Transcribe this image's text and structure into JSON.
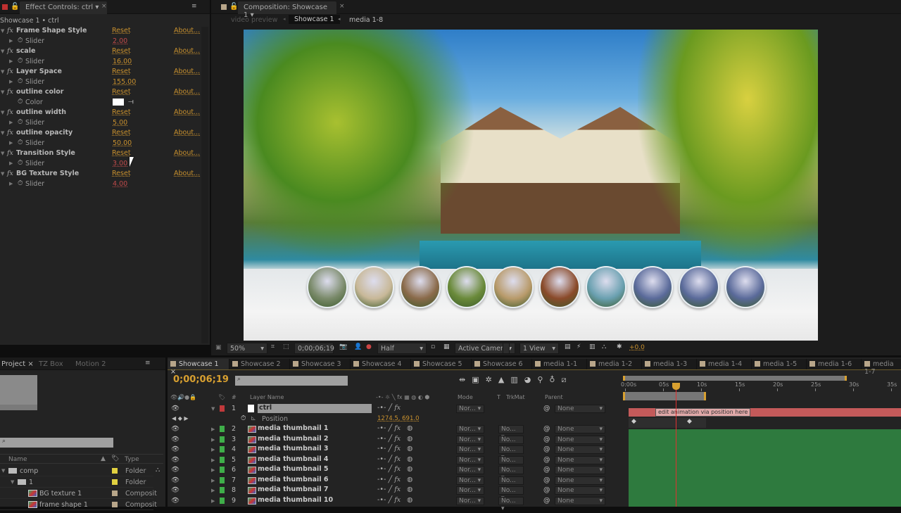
{
  "effect_controls": {
    "title": "Effect Controls: ctrl",
    "subtitle": "Showcase 1 • ctrl",
    "reset": "Reset",
    "about": "About...",
    "effects": [
      {
        "name": "Frame Shape Style",
        "prop": "Slider",
        "value": "2.00",
        "value_color": "#c04a4a"
      },
      {
        "name": "scale",
        "prop": "Slider",
        "value": "16.00",
        "value_color": "#c9912e"
      },
      {
        "name": "Layer Space",
        "prop": "Slider",
        "value": "155.00",
        "value_color": "#c9912e"
      },
      {
        "name": "outline color",
        "prop": "Color",
        "value": "",
        "swatch": "#ffffff"
      },
      {
        "name": "outline width",
        "prop": "Slider",
        "value": "5.00",
        "value_color": "#c9912e"
      },
      {
        "name": "outline opacity",
        "prop": "Slider",
        "value": "50.00",
        "value_color": "#c9912e"
      },
      {
        "name": "Transition Style",
        "prop": "Slider",
        "value": "3.00",
        "value_color": "#c04a4a"
      },
      {
        "name": "BG Texture Style",
        "prop": "Slider",
        "value": "4.00",
        "value_color": "#c04a4a"
      }
    ]
  },
  "composition": {
    "title": "Composition: Showcase 1",
    "breadcrumb": [
      "video preview",
      "Showcase 1",
      "media 1-8"
    ],
    "toolbar": {
      "zoom": "50%",
      "timecode": "0;00;06;19",
      "resolution": "Half",
      "camera": "Active Camera",
      "views": "1 View",
      "exposure": "+0.0"
    }
  },
  "project": {
    "tabs": [
      "Project",
      "TZ Box",
      "Motion 2"
    ],
    "search_placeholder": "",
    "columns": [
      "Name",
      "Type"
    ],
    "items": [
      {
        "name": "comp",
        "type": "Folder",
        "label": "#e0d040",
        "depth": 0,
        "kind": "folder"
      },
      {
        "name": "1",
        "type": "Folder",
        "label": "#e0d040",
        "depth": 1,
        "kind": "folder"
      },
      {
        "name": "BG texture 1",
        "type": "Composit",
        "label": "#b8a68a",
        "depth": 2,
        "kind": "comp"
      },
      {
        "name": "frame shape 1",
        "type": "Composit",
        "label": "#b8a68a",
        "depth": 2,
        "kind": "comp"
      }
    ]
  },
  "timeline": {
    "tabs": [
      "Showcase 1",
      "Showcase 2",
      "Showcase 3",
      "Showcase 4",
      "Showcase 5",
      "Showcase 6",
      "media 1-1",
      "media 1-2",
      "media 1-3",
      "media 1-4",
      "media 1-5",
      "media 1-6",
      "media 1-7"
    ],
    "timecode": "0;00;06;19",
    "columns": {
      "num": "#",
      "name": "Layer Name",
      "mode": "Mode",
      "t": "T",
      "trkmat": "TrkMat",
      "parent": "Parent"
    },
    "ruler": [
      "0:00s",
      "05s",
      "10s",
      "15s",
      "20s",
      "25s",
      "30s",
      "35s"
    ],
    "current_time_seconds": 6.63,
    "position": {
      "label": "Position",
      "value": "1274.5, 691.0"
    },
    "marker_comment": "edit animation via position here",
    "layers": [
      {
        "num": "1",
        "name": "ctrl",
        "label": "#c0393b",
        "mode": "Nor...",
        "trkmat": "",
        "parent": "None",
        "solid": true
      },
      {
        "num": "2",
        "name": "media thumbnail 1",
        "label": "#3fae49",
        "mode": "Nor...",
        "trkmat": "No...",
        "parent": "None"
      },
      {
        "num": "3",
        "name": "media thumbnail 2",
        "label": "#3fae49",
        "mode": "Nor...",
        "trkmat": "No...",
        "parent": "None"
      },
      {
        "num": "4",
        "name": "media thumbnail 3",
        "label": "#3fae49",
        "mode": "Nor...",
        "trkmat": "No...",
        "parent": "None"
      },
      {
        "num": "5",
        "name": "media thumbnail 4",
        "label": "#3fae49",
        "mode": "Nor...",
        "trkmat": "No...",
        "parent": "None"
      },
      {
        "num": "6",
        "name": "media thumbnail 5",
        "label": "#3fae49",
        "mode": "Nor...",
        "trkmat": "No...",
        "parent": "None"
      },
      {
        "num": "7",
        "name": "media thumbnail 6",
        "label": "#3fae49",
        "mode": "Nor...",
        "trkmat": "No...",
        "parent": "None"
      },
      {
        "num": "8",
        "name": "media thumbnail 7",
        "label": "#3fae49",
        "mode": "Nor...",
        "trkmat": "No...",
        "parent": "None"
      },
      {
        "num": "9",
        "name": "media thumbnail 10",
        "label": "#3fae49",
        "mode": "Nor...",
        "trkmat": "No...",
        "parent": "None"
      }
    ]
  },
  "thumbnails": [
    "#7a8a6a",
    "#c8b898",
    "#8a6a4a",
    "#6a8a3a",
    "#b89a6a",
    "#8a4a2a",
    "#6aa0b0",
    "#5a6a9a",
    "#5a6a9a",
    "#5a6a9a"
  ]
}
